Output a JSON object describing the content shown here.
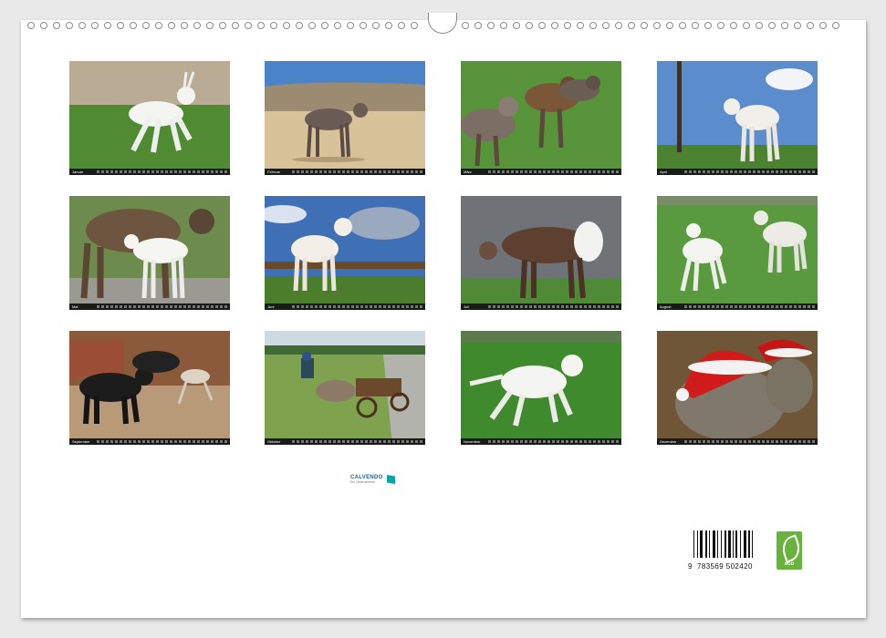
{
  "calendar": {
    "months": [
      {
        "label": "Januar",
        "scene": "white-foal-running"
      },
      {
        "label": "Februar",
        "scene": "grey-donkey-desert"
      },
      {
        "label": "März",
        "scene": "brown-donkey-group"
      },
      {
        "label": "April",
        "scene": "white-donkey-sky"
      },
      {
        "label": "Mai",
        "scene": "mother-and-white-foal"
      },
      {
        "label": "Juni",
        "scene": "white-donkey-clouds"
      },
      {
        "label": "Juli",
        "scene": "donkey-by-barn"
      },
      {
        "label": "August",
        "scene": "two-white-foals"
      },
      {
        "label": "September",
        "scene": "black-ponies-and-foal"
      },
      {
        "label": "Oktober",
        "scene": "donkey-cart-road"
      },
      {
        "label": "November",
        "scene": "white-foal-galloping"
      },
      {
        "label": "Dezember",
        "scene": "donkeys-with-santa-hats"
      }
    ]
  },
  "publisher": {
    "name": "CALVENDO",
    "tagline": "Ein Unternehmen"
  },
  "barcode": {
    "isbn_prefix": "9",
    "isbn_rest": "783569 502420"
  },
  "eco_badge": {
    "label": "eco"
  },
  "colors": {
    "sheet": "#ffffff",
    "grass": "#4d8a2c",
    "sky": "#4f86c9",
    "eco_green": "#6ab23e",
    "calvendo_blue": "#1d5d8f"
  }
}
